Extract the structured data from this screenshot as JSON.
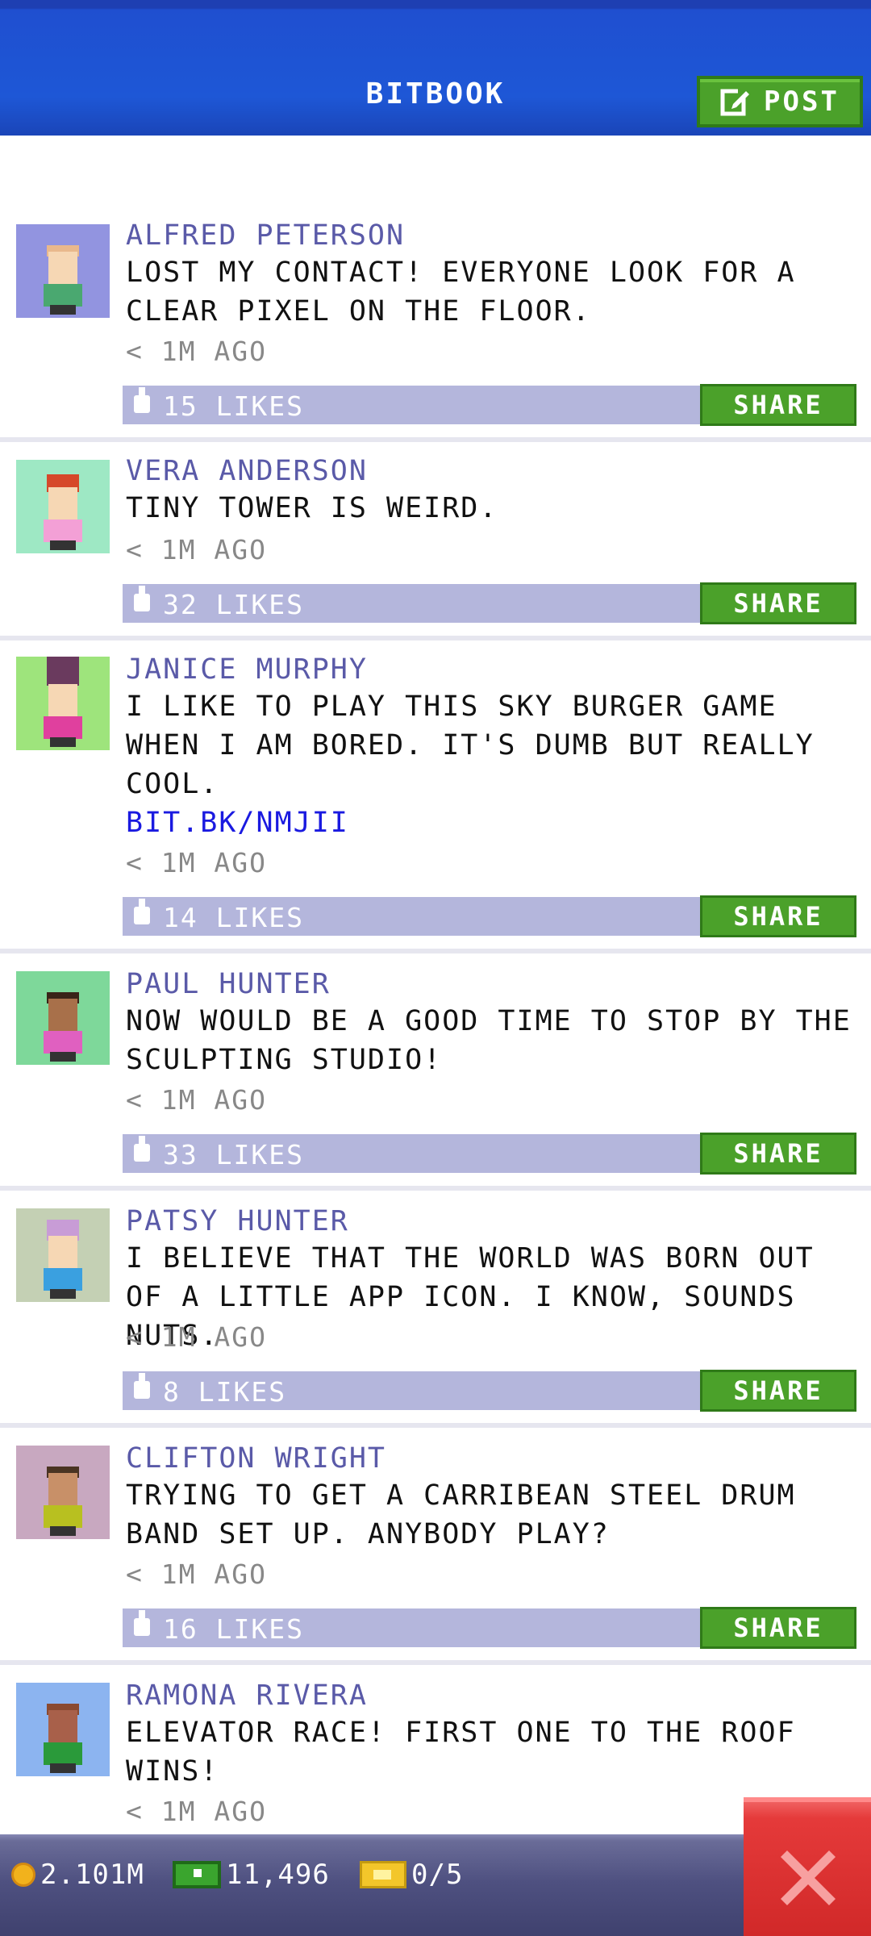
{
  "header": {
    "title": "BITBOOK",
    "post_label": "POST"
  },
  "posts": [
    {
      "name": "ALFRED PETERSON",
      "text": "LOST MY CONTACT! EVERYONE LOOK FOR A CLEAR PIXEL ON THE FLOOR.",
      "time": "< 1M AGO",
      "likes": "15 LIKES",
      "share": "SHARE",
      "avatar_bg": "#9294e0",
      "hair": "#e9b88c",
      "shirt": "#4aa870"
    },
    {
      "name": "VERA ANDERSON",
      "text": "TINY TOWER IS WEIRD.",
      "time": "< 1M AGO",
      "likes": "32 LIKES",
      "share": "SHARE",
      "avatar_bg": "#9ee8c4",
      "hair": "#d6482a",
      "shirt": "#f3a0d6"
    },
    {
      "name": "JANICE MURPHY",
      "text": "I LIKE TO PLAY THIS SKY BURGER GAME WHEN I AM BORED. IT'S DUMB BUT REALLY COOL.",
      "link": "BIT.BK/NMJII",
      "time": "< 1M AGO",
      "likes": "14 LIKES",
      "share": "SHARE",
      "avatar_bg": "#9ee47c",
      "hair": "#6a3a5e",
      "shirt": "#e0409e"
    },
    {
      "name": "PAUL HUNTER",
      "text": "NOW WOULD BE A GOOD TIME TO STOP BY THE SCULPTING STUDIO!",
      "time": "< 1M AGO",
      "likes": "33 LIKES",
      "share": "SHARE",
      "avatar_bg": "#7ed89a",
      "hair": "#3a2418",
      "shirt": "#e060c0"
    },
    {
      "name": "PATSY HUNTER",
      "text": "I BELIEVE THAT THE WORLD WAS BORN OUT OF A LITTLE APP ICON. I KNOW, SOUNDS NUTS.",
      "time": "< 1M AGO",
      "likes": "8 LIKES",
      "share": "SHARE",
      "avatar_bg": "#c4d0b4",
      "hair": "#c89cd6",
      "shirt": "#3aa0e0"
    },
    {
      "name": "CLIFTON WRIGHT",
      "text": "TRYING TO GET A CARRIBEAN STEEL DRUM BAND SET UP. ANYBODY PLAY?",
      "time": "< 1M AGO",
      "likes": "16 LIKES",
      "share": "SHARE",
      "avatar_bg": "#c8a8c0",
      "hair": "#4a3422",
      "shirt": "#b8c020"
    },
    {
      "name": "RAMONA RIVERA",
      "text": "ELEVATOR RACE! FIRST ONE TO THE ROOF WINS!",
      "time": "< 1M AGO",
      "avatar_bg": "#8cb4f0",
      "hair": "#8a4a30",
      "shirt": "#2a9a3a"
    }
  ],
  "footer": {
    "coins": "2.101M",
    "bux": "11,496",
    "tickets": "0/5"
  },
  "colors": {
    "header_blue": "#1e57d6",
    "share_green": "#4ba12a",
    "likes_bar": "#b4b6dc",
    "name_purple": "#5a5aa8",
    "close_red": "#e53a3a"
  }
}
